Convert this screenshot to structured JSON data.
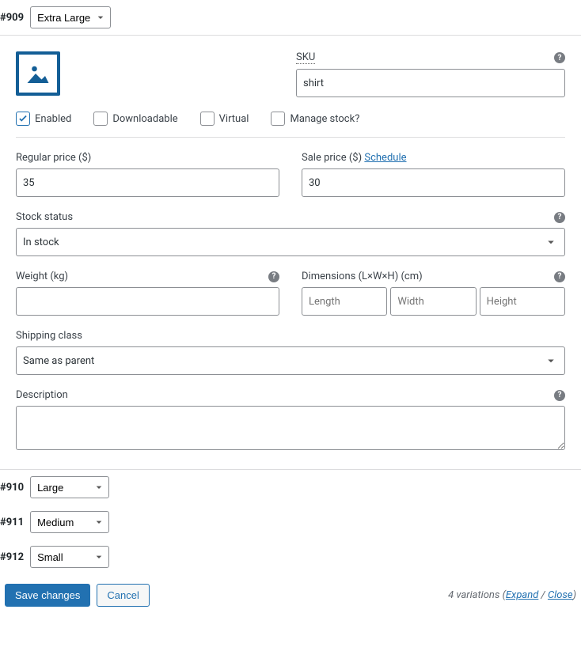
{
  "expanded_variation": {
    "id": "#909",
    "attribute_value": "Extra Large",
    "sku_label": "SKU",
    "sku_value": "shirt",
    "checks": {
      "enabled": {
        "label": "Enabled",
        "checked": true
      },
      "downloadable": {
        "label": "Downloadable",
        "checked": false
      },
      "virtual": {
        "label": "Virtual",
        "checked": false
      },
      "manage_stock": {
        "label": "Manage stock?",
        "checked": false
      }
    },
    "regular_price": {
      "label": "Regular price ($)",
      "value": "35"
    },
    "sale_price": {
      "label": "Sale price ($)",
      "value": "30",
      "schedule_link": "Schedule"
    },
    "stock_status": {
      "label": "Stock status",
      "value": "In stock"
    },
    "weight": {
      "label": "Weight (kg)",
      "value": ""
    },
    "dimensions": {
      "label": "Dimensions (L×W×H) (cm)",
      "length_ph": "Length",
      "width_ph": "Width",
      "height_ph": "Height"
    },
    "shipping_class": {
      "label": "Shipping class",
      "value": "Same as parent"
    },
    "description": {
      "label": "Description",
      "value": ""
    }
  },
  "collapsed_variations": [
    {
      "id": "#910",
      "attribute_value": "Large"
    },
    {
      "id": "#911",
      "attribute_value": "Medium"
    },
    {
      "id": "#912",
      "attribute_value": "Small"
    }
  ],
  "footer": {
    "save": "Save changes",
    "cancel": "Cancel",
    "count_text": "4 variations",
    "expand": "Expand",
    "close": "Close"
  },
  "help_glyph": "?"
}
